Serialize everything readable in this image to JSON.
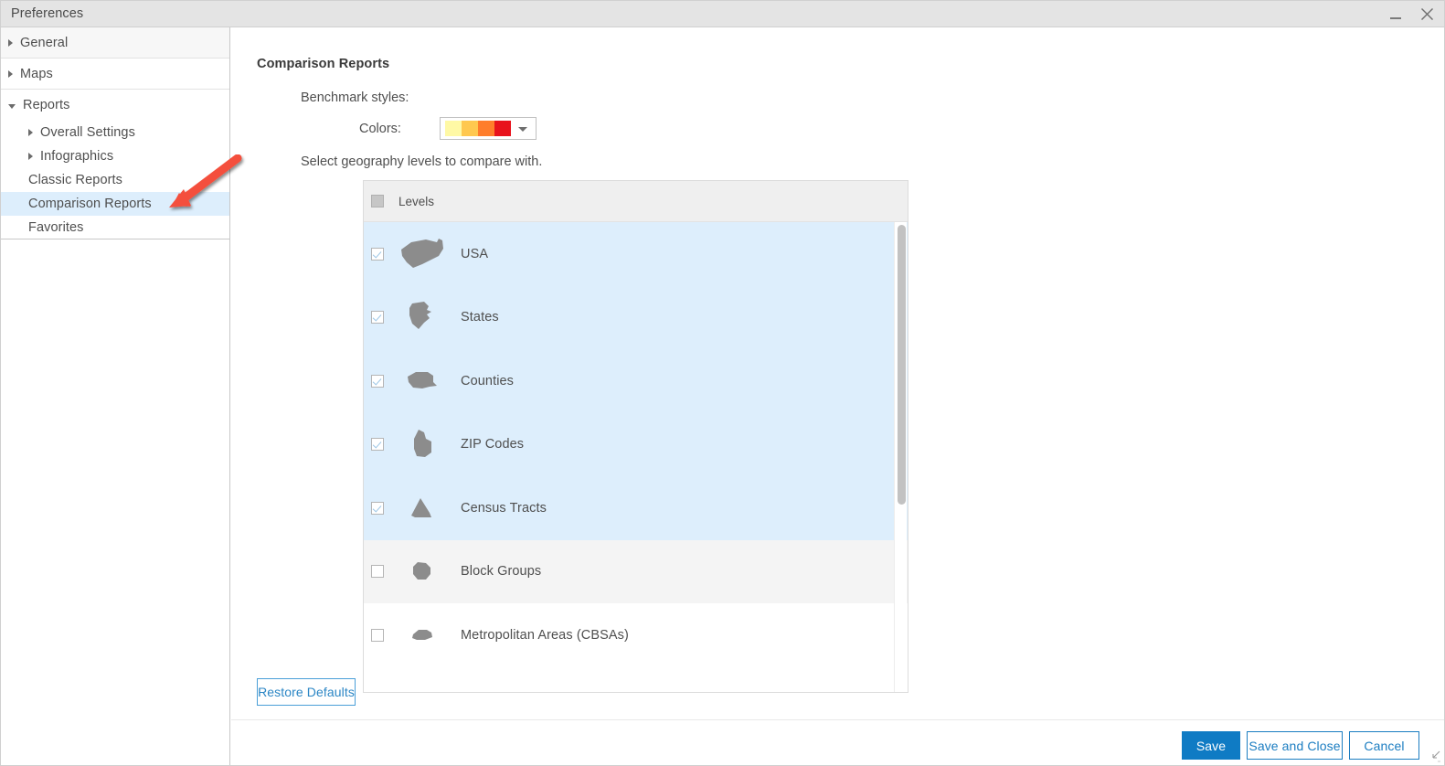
{
  "window": {
    "title": "Preferences",
    "minimize_icon": "minimize-icon",
    "close_icon": "close-icon",
    "resize_grip_icon": "resize-grip-icon"
  },
  "sidebar": {
    "groups": [
      {
        "label": "General",
        "icon": "chevron-right-icon",
        "expanded": false
      },
      {
        "label": "Maps",
        "icon": "chevron-right-icon",
        "expanded": false
      },
      {
        "label": "Reports",
        "icon": "chevron-down-icon",
        "expanded": true
      }
    ],
    "items": [
      {
        "label": "Overall Settings",
        "icon": "chevron-right-icon",
        "selected": false,
        "sub": true
      },
      {
        "label": "Infographics",
        "icon": "chevron-right-icon",
        "selected": false,
        "sub": true
      },
      {
        "label": "Classic Reports",
        "icon": "none",
        "selected": false,
        "sub": false
      },
      {
        "label": "Comparison Reports",
        "icon": "none",
        "selected": true,
        "sub": false
      },
      {
        "label": "Favorites",
        "icon": "none",
        "selected": false,
        "sub": false
      }
    ]
  },
  "main": {
    "section_title": "Comparison Reports",
    "benchmark_styles_label": "Benchmark styles:",
    "colors_label": "Colors:",
    "select_geography_label": "Select geography levels to compare with.",
    "colors_dropdown": {
      "caret_icon": "chevron-down-icon",
      "ramp": [
        "#FFF9A5",
        "#FFC84F",
        "#FF7D2B",
        "#E8121C"
      ]
    },
    "levels_table": {
      "header_label": "Levels",
      "header_checkbox_state": "indeterminate",
      "rows": [
        {
          "label": "USA",
          "checked": true,
          "icon": "usa-shape-icon",
          "row_style": "sel"
        },
        {
          "label": "States",
          "checked": true,
          "icon": "state-shape-icon",
          "row_style": "sel"
        },
        {
          "label": "Counties",
          "checked": true,
          "icon": "county-shape-icon",
          "row_style": "sel"
        },
        {
          "label": "ZIP Codes",
          "checked": true,
          "icon": "zip-shape-icon",
          "row_style": "sel"
        },
        {
          "label": "Census Tracts",
          "checked": true,
          "icon": "tract-shape-icon",
          "row_style": "sel"
        },
        {
          "label": "Block Groups",
          "checked": false,
          "icon": "blockgroup-shape-icon",
          "row_style": "alt"
        },
        {
          "label": "Metropolitan Areas (CBSAs)",
          "checked": false,
          "icon": "cbsa-shape-icon",
          "row_style": "plain"
        }
      ]
    }
  },
  "footer": {
    "restore_defaults_label": "Restore Defaults",
    "save_label": "Save",
    "save_and_close_label": "Save and Close",
    "cancel_label": "Cancel"
  },
  "annotation": {
    "arrow_color": "#F4503C",
    "arrow_target": "Comparison Reports"
  },
  "colors": {
    "accent_blue": "#0f7bc4",
    "link_blue": "#1b7dc1",
    "selected_row": "#ddeefc",
    "titlebar_bg": "#e4e4e4",
    "shape_gray": "#8c8c8c"
  }
}
